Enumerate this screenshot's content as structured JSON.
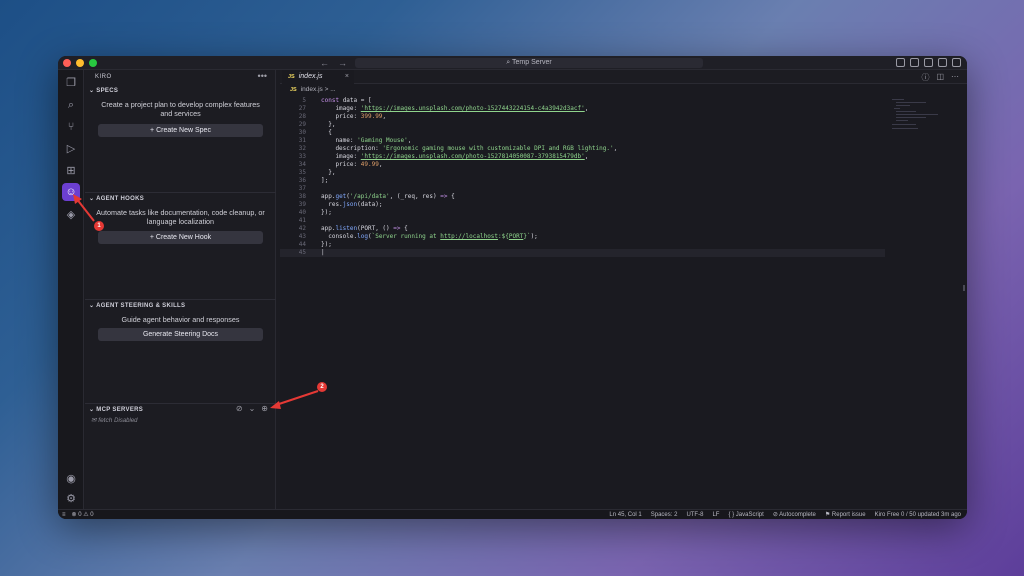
{
  "window": {
    "title": "Temp Server",
    "colors": {
      "accent": "#6c3fd1",
      "annotation": "#e53935"
    }
  },
  "activity_bar": {
    "items": [
      {
        "name": "explorer",
        "glyph": "❐"
      },
      {
        "name": "search",
        "glyph": "⌕"
      },
      {
        "name": "source-control",
        "glyph": "⑂"
      },
      {
        "name": "run-debug",
        "glyph": "▷"
      },
      {
        "name": "extensions",
        "glyph": "⊞"
      },
      {
        "name": "kiro",
        "glyph": "☺"
      },
      {
        "name": "remote",
        "glyph": "◈"
      }
    ],
    "bottom": [
      {
        "name": "account",
        "glyph": "◉"
      },
      {
        "name": "settings",
        "glyph": "⚙"
      }
    ]
  },
  "sidebar": {
    "header": "KIRO",
    "more": "•••",
    "specs": {
      "title": "SPECS",
      "description": "Create a project plan to develop complex features and services",
      "button": "+ Create New Spec"
    },
    "hooks": {
      "title": "AGENT HOOKS",
      "description": "Automate tasks like documentation, code cleanup, or language localization",
      "button": "+ Create New Hook"
    },
    "steering": {
      "title": "AGENT STEERING & SKILLS",
      "description": "Guide agent behavior and responses",
      "button": "Generate Steering Docs"
    },
    "mcp": {
      "title": "MCP SERVERS",
      "server_name": "fetch",
      "server_status": "Disabled"
    }
  },
  "editor": {
    "tab": {
      "badge": "JS",
      "label": "index.js",
      "close": "×"
    },
    "breadcrumb": {
      "badge": "JS",
      "file": "index.js",
      "rest": "> ..."
    },
    "lines": [
      {
        "n": "5",
        "parts": [
          [
            "kw",
            "const "
          ],
          [
            "prop",
            "data = ["
          ]
        ]
      },
      {
        "n": "27",
        "parts": [
          [
            "prop",
            "    image: "
          ],
          [
            "url",
            "'https://images.unsplash.com/photo-1527443224154-c4a3942d3acf'"
          ],
          [
            "prop",
            ","
          ]
        ]
      },
      {
        "n": "28",
        "parts": [
          [
            "prop",
            "    price: "
          ],
          [
            "num",
            "399.99"
          ],
          [
            "prop",
            ","
          ]
        ]
      },
      {
        "n": "29",
        "parts": [
          [
            "prop",
            "  },"
          ]
        ]
      },
      {
        "n": "30",
        "parts": [
          [
            "prop",
            "  {"
          ]
        ]
      },
      {
        "n": "31",
        "parts": [
          [
            "prop",
            "    name: "
          ],
          [
            "str",
            "'Gaming Mouse'"
          ],
          [
            "prop",
            ","
          ]
        ]
      },
      {
        "n": "32",
        "parts": [
          [
            "prop",
            "    description: "
          ],
          [
            "str",
            "'Ergonomic gaming mouse with customizable DPI and RGB lighting.'"
          ],
          [
            "prop",
            ","
          ]
        ]
      },
      {
        "n": "33",
        "parts": [
          [
            "prop",
            "    image: "
          ],
          [
            "url",
            "'https://images.unsplash.com/photo-1527814050087-3793815479db'"
          ],
          [
            "prop",
            ","
          ]
        ]
      },
      {
        "n": "34",
        "parts": [
          [
            "prop",
            "    price: "
          ],
          [
            "num",
            "49.99"
          ],
          [
            "prop",
            ","
          ]
        ]
      },
      {
        "n": "35",
        "parts": [
          [
            "prop",
            "  },"
          ]
        ]
      },
      {
        "n": "36",
        "parts": [
          [
            "prop",
            "];"
          ]
        ]
      },
      {
        "n": "37",
        "parts": []
      },
      {
        "n": "38",
        "parts": [
          [
            "prop",
            "app."
          ],
          [
            "fn",
            "get"
          ],
          [
            "prop",
            "("
          ],
          [
            "str",
            "'/api/data'"
          ],
          [
            "prop",
            ", (_req, res) "
          ],
          [
            "kw",
            "=>"
          ],
          [
            "prop",
            " {"
          ]
        ]
      },
      {
        "n": "39",
        "parts": [
          [
            "prop",
            "  res."
          ],
          [
            "fn",
            "json"
          ],
          [
            "prop",
            "(data);"
          ]
        ]
      },
      {
        "n": "40",
        "parts": [
          [
            "prop",
            "});"
          ]
        ]
      },
      {
        "n": "41",
        "parts": []
      },
      {
        "n": "42",
        "parts": [
          [
            "prop",
            "app."
          ],
          [
            "fn",
            "listen"
          ],
          [
            "prop",
            "(PORT, () "
          ],
          [
            "kw",
            "=>"
          ],
          [
            "prop",
            " {"
          ]
        ]
      },
      {
        "n": "43",
        "parts": [
          [
            "prop",
            "  console."
          ],
          [
            "fn",
            "log"
          ],
          [
            "prop",
            "("
          ],
          [
            "str",
            "`Server running at "
          ],
          [
            "url",
            "http://localhost"
          ],
          [
            "str",
            ":${"
          ],
          [
            "url",
            "PORT"
          ],
          [
            "str",
            "}`"
          ],
          [
            "prop",
            ");"
          ]
        ]
      },
      {
        "n": "44",
        "parts": [
          [
            "prop",
            "});"
          ]
        ]
      },
      {
        "n": "45",
        "parts": [
          [
            "prop",
            "|"
          ]
        ],
        "current": true
      }
    ]
  },
  "statusbar": {
    "problems": "⊗ 0 ⚠ 0",
    "position": "Ln 45, Col 1",
    "spaces": "Spaces: 2",
    "encoding": "UTF-8",
    "eol": "LF",
    "language": "{ } JavaScript",
    "autocomplete": "⊘ Autocomplete",
    "report": "⚑ Report issue",
    "plan": "Kiro Free 0 / 50 updated 3m ago"
  },
  "annotations": [
    {
      "label": "1"
    },
    {
      "label": "2"
    }
  ]
}
